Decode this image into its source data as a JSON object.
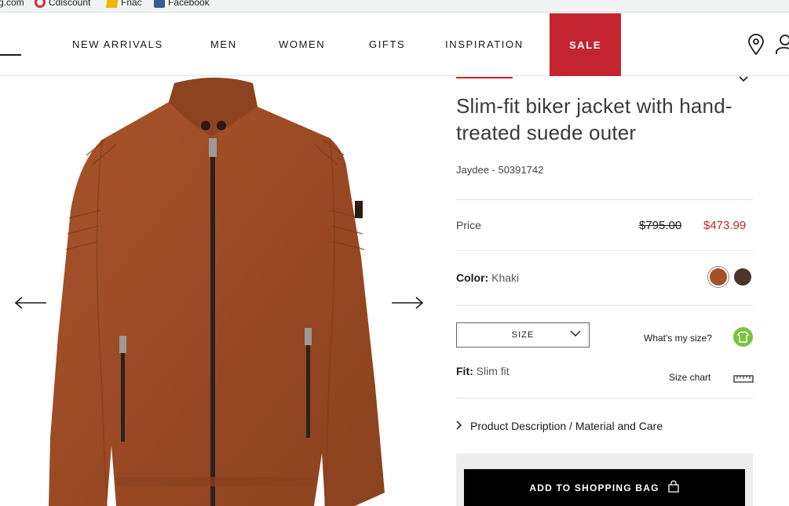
{
  "bookmarks": [
    {
      "label": "g.com"
    },
    {
      "label": "Cdiscount"
    },
    {
      "label": "Fnac"
    },
    {
      "label": "Facebook"
    }
  ],
  "nav": {
    "items": [
      "NEW ARRIVALS",
      "MEN",
      "WOMEN",
      "GIFTS",
      "INSPIRATION"
    ],
    "sale": "SALE",
    "sale_color": "#c3242f"
  },
  "header_icons": [
    "location-pin-icon",
    "user-icon"
  ],
  "gallery": {
    "prev_icon": "arrow-left-icon",
    "next_icon": "arrow-right-icon",
    "image": "product-jacket-image"
  },
  "product": {
    "title": "Slim-fit biker jacket with hand-treated suede outer",
    "sku": "Jaydee - 50391742",
    "price_label": "Price",
    "price_old": "$795.00",
    "price_new": "$473.99",
    "color_label": "Color:",
    "color_value": "Khaki",
    "swatches": [
      "#a4512b",
      "#4a3626"
    ],
    "size_label": "SIZE",
    "whats_my_size": "What's my size?",
    "fit_label": "Fit:",
    "fit_value": "Slim fit",
    "size_chart": "Size chart",
    "description_toggle": "Product Description / Material and Care",
    "add_to_bag": "ADD TO SHOPPING BAG"
  }
}
